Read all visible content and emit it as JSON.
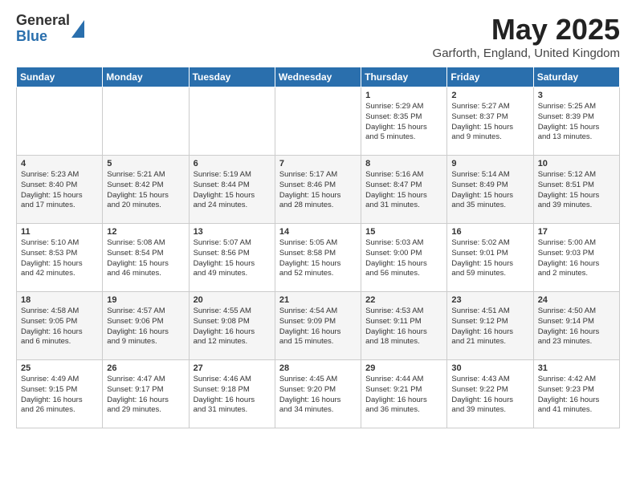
{
  "logo": {
    "line1": "General",
    "line2": "Blue"
  },
  "title": "May 2025",
  "subtitle": "Garforth, England, United Kingdom",
  "headers": [
    "Sunday",
    "Monday",
    "Tuesday",
    "Wednesday",
    "Thursday",
    "Friday",
    "Saturday"
  ],
  "weeks": [
    [
      {
        "day": "",
        "info": ""
      },
      {
        "day": "",
        "info": ""
      },
      {
        "day": "",
        "info": ""
      },
      {
        "day": "",
        "info": ""
      },
      {
        "day": "1",
        "info": "Sunrise: 5:29 AM\nSunset: 8:35 PM\nDaylight: 15 hours\nand 5 minutes."
      },
      {
        "day": "2",
        "info": "Sunrise: 5:27 AM\nSunset: 8:37 PM\nDaylight: 15 hours\nand 9 minutes."
      },
      {
        "day": "3",
        "info": "Sunrise: 5:25 AM\nSunset: 8:39 PM\nDaylight: 15 hours\nand 13 minutes."
      }
    ],
    [
      {
        "day": "4",
        "info": "Sunrise: 5:23 AM\nSunset: 8:40 PM\nDaylight: 15 hours\nand 17 minutes."
      },
      {
        "day": "5",
        "info": "Sunrise: 5:21 AM\nSunset: 8:42 PM\nDaylight: 15 hours\nand 20 minutes."
      },
      {
        "day": "6",
        "info": "Sunrise: 5:19 AM\nSunset: 8:44 PM\nDaylight: 15 hours\nand 24 minutes."
      },
      {
        "day": "7",
        "info": "Sunrise: 5:17 AM\nSunset: 8:46 PM\nDaylight: 15 hours\nand 28 minutes."
      },
      {
        "day": "8",
        "info": "Sunrise: 5:16 AM\nSunset: 8:47 PM\nDaylight: 15 hours\nand 31 minutes."
      },
      {
        "day": "9",
        "info": "Sunrise: 5:14 AM\nSunset: 8:49 PM\nDaylight: 15 hours\nand 35 minutes."
      },
      {
        "day": "10",
        "info": "Sunrise: 5:12 AM\nSunset: 8:51 PM\nDaylight: 15 hours\nand 39 minutes."
      }
    ],
    [
      {
        "day": "11",
        "info": "Sunrise: 5:10 AM\nSunset: 8:53 PM\nDaylight: 15 hours\nand 42 minutes."
      },
      {
        "day": "12",
        "info": "Sunrise: 5:08 AM\nSunset: 8:54 PM\nDaylight: 15 hours\nand 46 minutes."
      },
      {
        "day": "13",
        "info": "Sunrise: 5:07 AM\nSunset: 8:56 PM\nDaylight: 15 hours\nand 49 minutes."
      },
      {
        "day": "14",
        "info": "Sunrise: 5:05 AM\nSunset: 8:58 PM\nDaylight: 15 hours\nand 52 minutes."
      },
      {
        "day": "15",
        "info": "Sunrise: 5:03 AM\nSunset: 9:00 PM\nDaylight: 15 hours\nand 56 minutes."
      },
      {
        "day": "16",
        "info": "Sunrise: 5:02 AM\nSunset: 9:01 PM\nDaylight: 15 hours\nand 59 minutes."
      },
      {
        "day": "17",
        "info": "Sunrise: 5:00 AM\nSunset: 9:03 PM\nDaylight: 16 hours\nand 2 minutes."
      }
    ],
    [
      {
        "day": "18",
        "info": "Sunrise: 4:58 AM\nSunset: 9:05 PM\nDaylight: 16 hours\nand 6 minutes."
      },
      {
        "day": "19",
        "info": "Sunrise: 4:57 AM\nSunset: 9:06 PM\nDaylight: 16 hours\nand 9 minutes."
      },
      {
        "day": "20",
        "info": "Sunrise: 4:55 AM\nSunset: 9:08 PM\nDaylight: 16 hours\nand 12 minutes."
      },
      {
        "day": "21",
        "info": "Sunrise: 4:54 AM\nSunset: 9:09 PM\nDaylight: 16 hours\nand 15 minutes."
      },
      {
        "day": "22",
        "info": "Sunrise: 4:53 AM\nSunset: 9:11 PM\nDaylight: 16 hours\nand 18 minutes."
      },
      {
        "day": "23",
        "info": "Sunrise: 4:51 AM\nSunset: 9:12 PM\nDaylight: 16 hours\nand 21 minutes."
      },
      {
        "day": "24",
        "info": "Sunrise: 4:50 AM\nSunset: 9:14 PM\nDaylight: 16 hours\nand 23 minutes."
      }
    ],
    [
      {
        "day": "25",
        "info": "Sunrise: 4:49 AM\nSunset: 9:15 PM\nDaylight: 16 hours\nand 26 minutes."
      },
      {
        "day": "26",
        "info": "Sunrise: 4:47 AM\nSunset: 9:17 PM\nDaylight: 16 hours\nand 29 minutes."
      },
      {
        "day": "27",
        "info": "Sunrise: 4:46 AM\nSunset: 9:18 PM\nDaylight: 16 hours\nand 31 minutes."
      },
      {
        "day": "28",
        "info": "Sunrise: 4:45 AM\nSunset: 9:20 PM\nDaylight: 16 hours\nand 34 minutes."
      },
      {
        "day": "29",
        "info": "Sunrise: 4:44 AM\nSunset: 9:21 PM\nDaylight: 16 hours\nand 36 minutes."
      },
      {
        "day": "30",
        "info": "Sunrise: 4:43 AM\nSunset: 9:22 PM\nDaylight: 16 hours\nand 39 minutes."
      },
      {
        "day": "31",
        "info": "Sunrise: 4:42 AM\nSunset: 9:23 PM\nDaylight: 16 hours\nand 41 minutes."
      }
    ]
  ]
}
